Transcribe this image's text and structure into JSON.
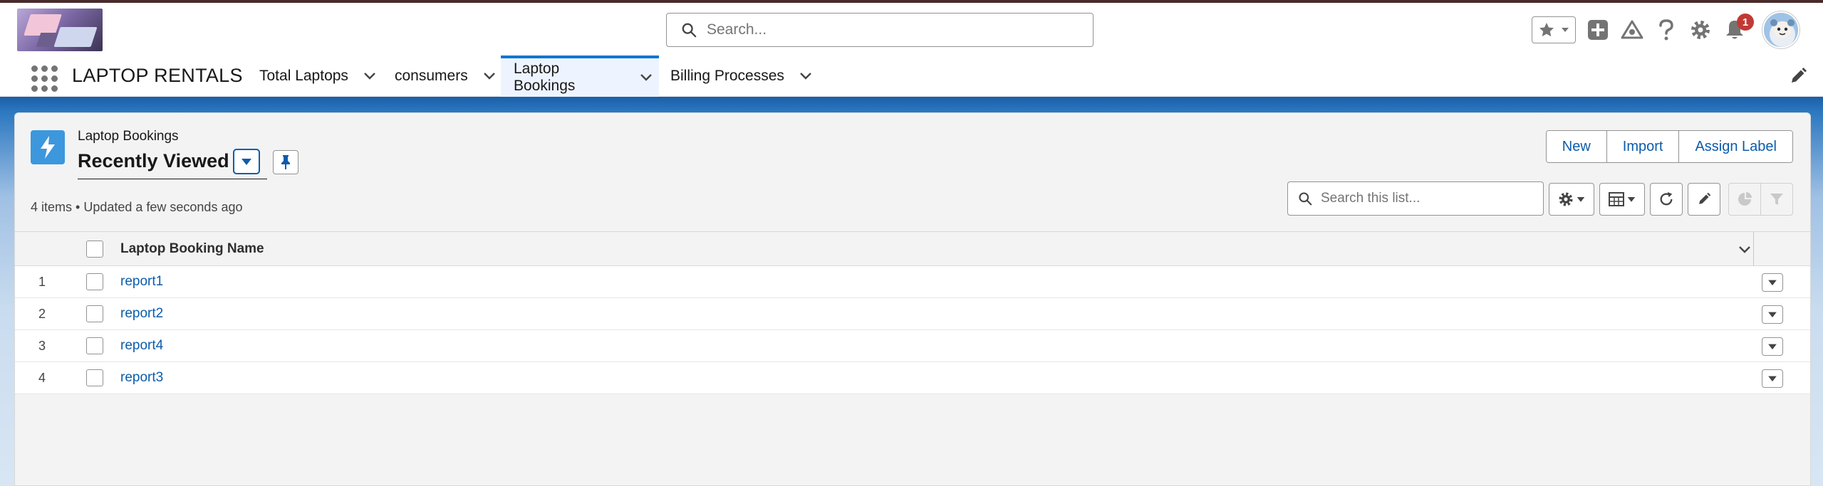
{
  "app": {
    "name": "LAPTOP RENTALS"
  },
  "global_search": {
    "placeholder": "Search..."
  },
  "notifications": {
    "count": "1"
  },
  "nav": {
    "items": [
      {
        "label": "Total Laptops"
      },
      {
        "label": "consumers"
      },
      {
        "label": "Laptop Bookings",
        "active": true
      },
      {
        "label": "Billing Processes"
      }
    ]
  },
  "list_view": {
    "object_label": "Laptop Bookings",
    "title": "Recently Viewed",
    "meta": "4 items • Updated a few seconds ago",
    "search_placeholder": "Search this list...",
    "actions": {
      "new": "New",
      "import": "Import",
      "assign_label": "Assign Label"
    },
    "columns": [
      "Laptop Booking Name"
    ],
    "rows": [
      {
        "num": "1",
        "name": "report1"
      },
      {
        "num": "2",
        "name": "report2"
      },
      {
        "num": "3",
        "name": "report4"
      },
      {
        "num": "4",
        "name": "report3"
      }
    ]
  },
  "colors": {
    "brand": "#0176d3",
    "link": "#0b5cab",
    "object_icon": "#3c97dd",
    "badge": "#c23934"
  }
}
